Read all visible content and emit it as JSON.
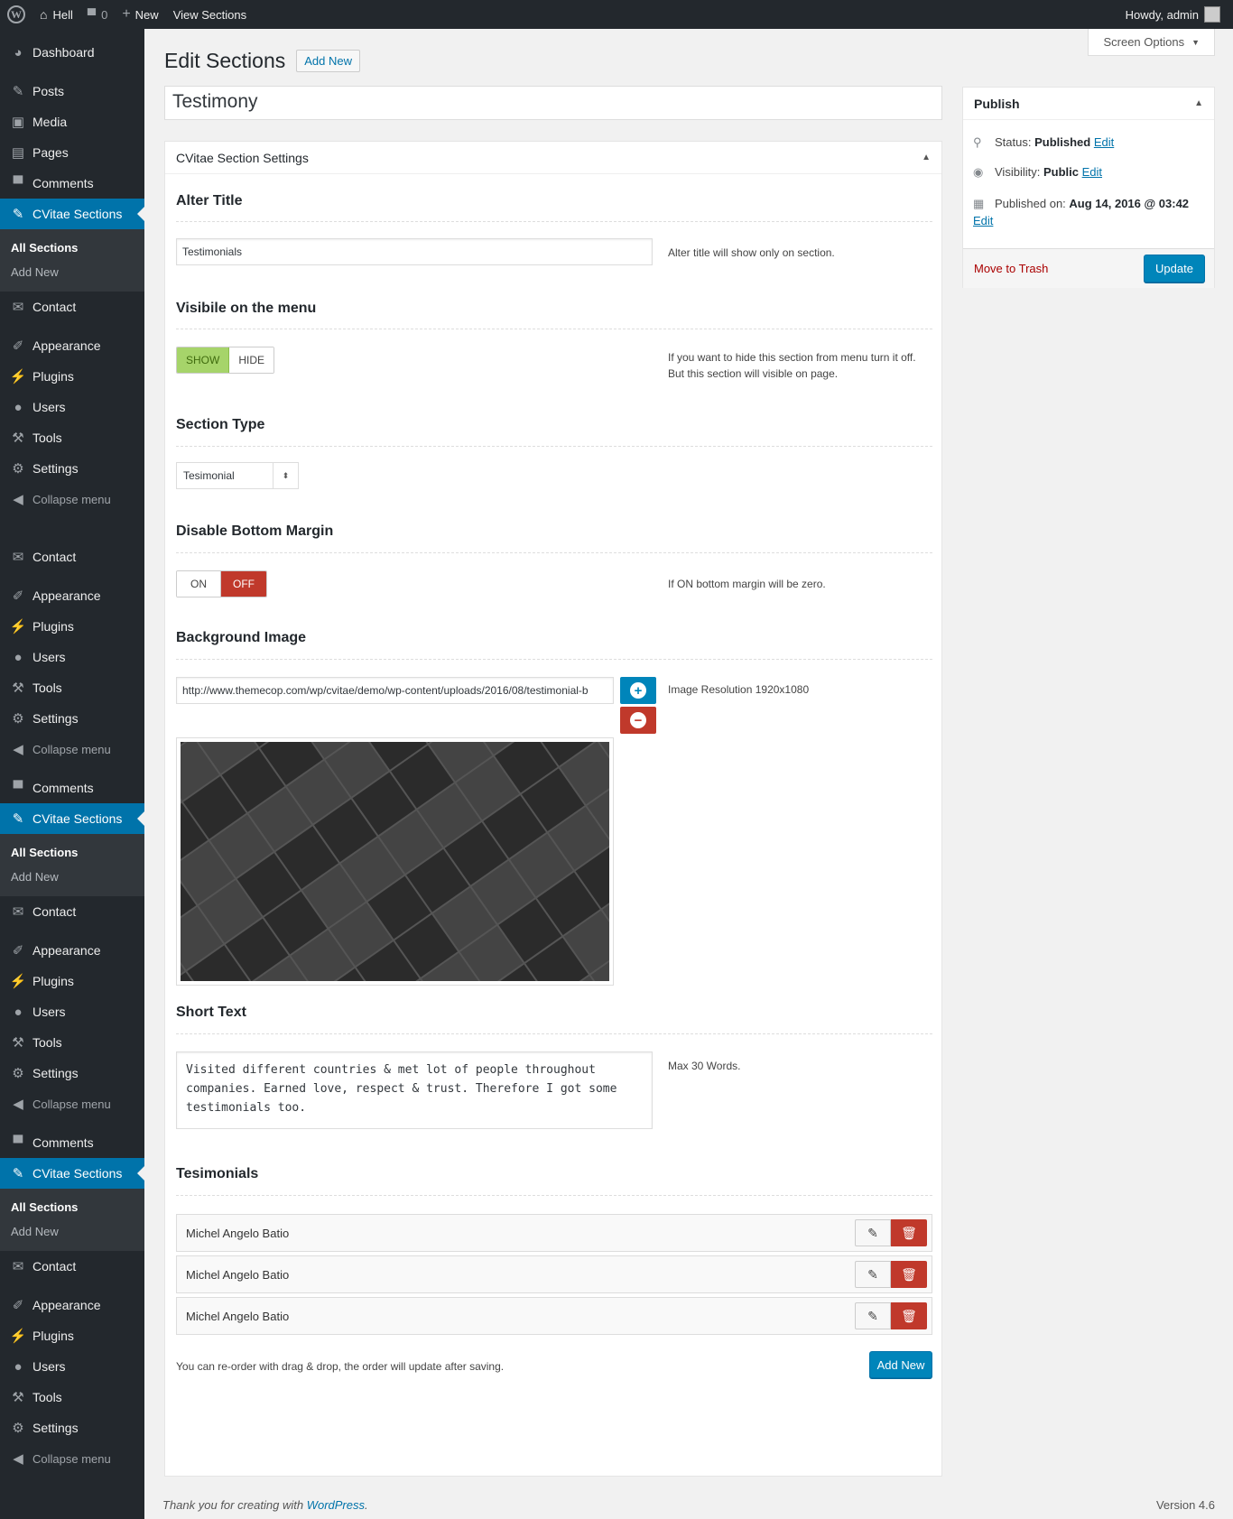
{
  "adminbar": {
    "site_name": "Hell",
    "comments_count": "0",
    "new_label": "New",
    "view_label": "View Sections",
    "howdy": "Howdy, admin"
  },
  "menu": {
    "dashboard": "Dashboard",
    "posts": "Posts",
    "media": "Media",
    "pages": "Pages",
    "comments": "Comments",
    "cvitae": "CVitae Sections",
    "all_sections": "All Sections",
    "add_new": "Add New",
    "contact": "Contact",
    "appearance": "Appearance",
    "plugins": "Plugins",
    "users": "Users",
    "tools": "Tools",
    "settings": "Settings",
    "collapse": "Collapse menu"
  },
  "screen_options": "Screen Options",
  "page": {
    "title": "Edit Sections",
    "add_new": "Add New",
    "post_title": "Testimony"
  },
  "settings_box": {
    "title": "CVitae Section Settings",
    "alter_title": {
      "label": "Alter Title",
      "value": "Testimonials",
      "desc": "Alter title will show only on section."
    },
    "visible_menu": {
      "label": "Visibile on the menu",
      "show": "SHOW",
      "hide": "HIDE",
      "selected": "SHOW",
      "desc": "If you want to hide this section from menu turn it off. But this section will visible on page."
    },
    "section_type": {
      "label": "Section Type",
      "value": "Tesimonial"
    },
    "bottom_margin": {
      "label": "Disable Bottom Margin",
      "on": "ON",
      "off": "OFF",
      "selected": "OFF",
      "desc": "If ON bottom margin will be zero."
    },
    "background_image": {
      "label": "Background Image",
      "url": "http://www.themecop.com/wp/cvitae/demo/wp-content/uploads/2016/08/testimonial-b",
      "desc": "Image Resolution 1920x1080"
    },
    "short_text": {
      "label": "Short Text",
      "value": "Visited different countries & met lot of people throughout companies. Earned love, respect & trust. Therefore I got some testimonials too.",
      "desc": "Max 30 Words."
    },
    "testimonials": {
      "label": "Tesimonials",
      "items": [
        "Michel Angelo Batio",
        "Michel Angelo Batio",
        "Michel Angelo Batio"
      ],
      "note": "You can re-order with drag & drop, the order will update after saving.",
      "add_new": "Add New"
    }
  },
  "publish": {
    "title": "Publish",
    "status_label": "Status:",
    "status_value": "Published",
    "visibility_label": "Visibility:",
    "visibility_value": "Public",
    "published_label": "Published on:",
    "published_value": "Aug 14, 2016 @ 03:42",
    "edit": "Edit",
    "trash": "Move to Trash",
    "update": "Update"
  },
  "footer": {
    "thanks": "Thank you for creating with ",
    "wp": "WordPress",
    "dot": ".",
    "version": "Version 4.6"
  },
  "colors": {
    "sidebar": "#23282d",
    "accent": "#0073aa",
    "danger": "#c0392b",
    "success": "#a6d46a"
  }
}
